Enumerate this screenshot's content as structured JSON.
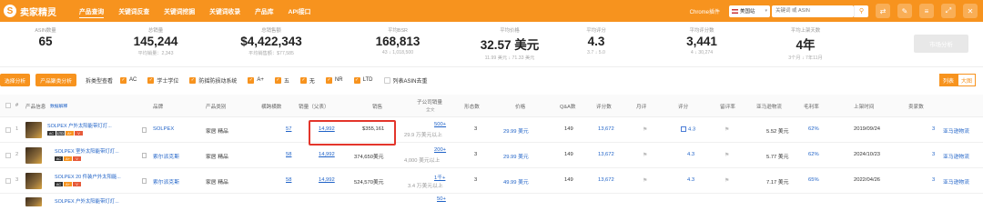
{
  "app": {
    "logo_text": "卖家精灵",
    "logo_glyph": "S"
  },
  "nav": [
    "产品查询",
    "关键词反查",
    "关键词挖掘",
    "关键词收录",
    "产品库",
    "API接口"
  ],
  "top": {
    "extension_link": "Chrome插件",
    "region": "美国站",
    "search_placeholder": "关键词 或 ASIN"
  },
  "stats": [
    {
      "label": "ASIN数量",
      "value": "65",
      "sub": ""
    },
    {
      "label": "总销量",
      "value": "145,244",
      "sub": "平均销量：2,343"
    },
    {
      "label": "总销售额",
      "value": "$4,422,343",
      "sub": "平均销售额：$77,585"
    },
    {
      "label": "平均BSR",
      "value": "168,813",
      "sub": "43 ↓ 1,018,500"
    },
    {
      "label": "平均价格",
      "value": "32.57 美元",
      "sub": "11.99 美元 ↓ 71.33 美元"
    },
    {
      "label": "平均评分",
      "value": "4.3",
      "sub": "3.7 ↓ 5.0"
    },
    {
      "label": "平均评分数",
      "value": "3,441",
      "sub": "4 ↓ 30,274"
    },
    {
      "label": "平均上架天数",
      "value": "4年",
      "sub": "3个月 ↓ 7年11月"
    }
  ],
  "market_btn": "市场分析",
  "filters": {
    "btn1": "选择分析",
    "btn2": "产品聚类分析",
    "link": "拆类型查看",
    "checks": [
      {
        "label": "AC",
        "on": true
      },
      {
        "label": "学士学位",
        "on": true
      },
      {
        "label": "防摇防损动系统",
        "on": true
      },
      {
        "label": "A+",
        "on": true
      },
      {
        "label": "五",
        "on": true
      },
      {
        "label": "无",
        "on": true
      },
      {
        "label": "NR",
        "on": true
      },
      {
        "label": "LTD",
        "on": true
      },
      {
        "label": "列表ASIN去重",
        "on": false
      }
    ],
    "toggle_left": "列表",
    "toggle_right": "大图"
  },
  "headers": {
    "idx": "#",
    "product": "产品信息",
    "product_hint": "数据解释",
    "brand": "品牌",
    "category": "产品类别",
    "variants": "横跨横数",
    "units": "销量（父表）",
    "revenue": "销售",
    "sub_units": "子公司销量",
    "sub_units_sub": "全文",
    "sellers": "形态数",
    "price": "价格",
    "qa": "Q&A数",
    "reviews": "评分数",
    "monthly": "月评",
    "rating": "评分",
    "rating_rate": "留评率",
    "shipping": "亚马逊物流",
    "fba_pct": "毛利率",
    "date": "上架时间",
    "sellers2": "卖家数",
    "fulfill": ""
  },
  "rows": [
    {
      "title": "SOLPEX 户外太阳能带灯灯...",
      "brand": "SOLPEX",
      "cat": "家居 精品",
      "var": "57",
      "units": "14,992",
      "rev": "$355,161",
      "sub1": "500+",
      "sub2": "29.9 万美元以上",
      "sellers": "3",
      "price": "29.99 美元",
      "qa": "149",
      "reviews": "13,672",
      "rating": "4.3",
      "fba": "5.52 美元",
      "pct": "62%",
      "date": "2019/09/24",
      "s2": "3",
      "ship": "亚马逊物流"
    },
    {
      "title": "SOLPEX 室外太阳能带灯灯...",
      "brand": "索尔派克斯",
      "cat": "家居 精品",
      "var": "58",
      "units": "14,992",
      "rev": "374,650美元",
      "sub1": "200+",
      "sub2": "4,000 美元以上",
      "sellers": "3",
      "price": "29.99 美元",
      "qa": "149",
      "reviews": "13,672",
      "rating": "4.3",
      "fba": "5.77 美元",
      "pct": "62%",
      "date": "2024/10/23",
      "s2": "3",
      "ship": "亚马逊物流"
    },
    {
      "title": "SOLPEX 20 件装户外太阳能...",
      "brand": "索尔派克斯",
      "cat": "家居 精品",
      "var": "58",
      "units": "14,992",
      "rev": "524,570美元",
      "sub1": "1千+",
      "sub2": "3.4 万美元以上",
      "sellers": "3",
      "price": "49.99 美元",
      "qa": "149",
      "reviews": "13,672",
      "rating": "4.3",
      "fba": "7.17 美元",
      "pct": "65%",
      "date": "2022/04/26",
      "s2": "3",
      "ship": "亚马逊物流"
    },
    {
      "title": "SOLPEX 户外太阳能带灯灯...",
      "sub1": "50+"
    }
  ],
  "colors": {
    "brand": "#f7931e",
    "link": "#1f62c7",
    "highlight": "#e3352b"
  }
}
